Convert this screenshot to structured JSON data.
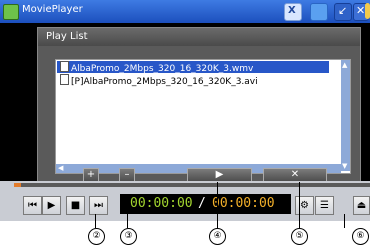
{
  "titlebar": {
    "title": "MoviePlayer",
    "icons": [
      "app-icon",
      "wifi-icon",
      "monitor-icon",
      "signal-icon",
      "close-x-icon",
      "home-icon"
    ]
  },
  "playlist": {
    "title": "Play List",
    "items": [
      {
        "name": "AlbaPromo_2Mbps_320_16_320K_3.wmv",
        "selected": true
      },
      {
        "name": "[P]AlbaPromo_2Mbps_320_16_320K_3.avi",
        "selected": false
      }
    ],
    "buttons": {
      "add": "+",
      "remove": "–",
      "play": "▶",
      "delete": "✕"
    }
  },
  "controls": {
    "progress": 0.02,
    "current_time": "00:00:00",
    "separator": "/",
    "total_time": "00:00:00"
  },
  "callouts": [
    "②",
    "③",
    "④",
    "⑤",
    "⑥"
  ],
  "colors": {
    "accent": "#e27b2a",
    "time_current": "#a3d62f",
    "time_total": "#f3b02a",
    "selection": "#2857c8"
  }
}
